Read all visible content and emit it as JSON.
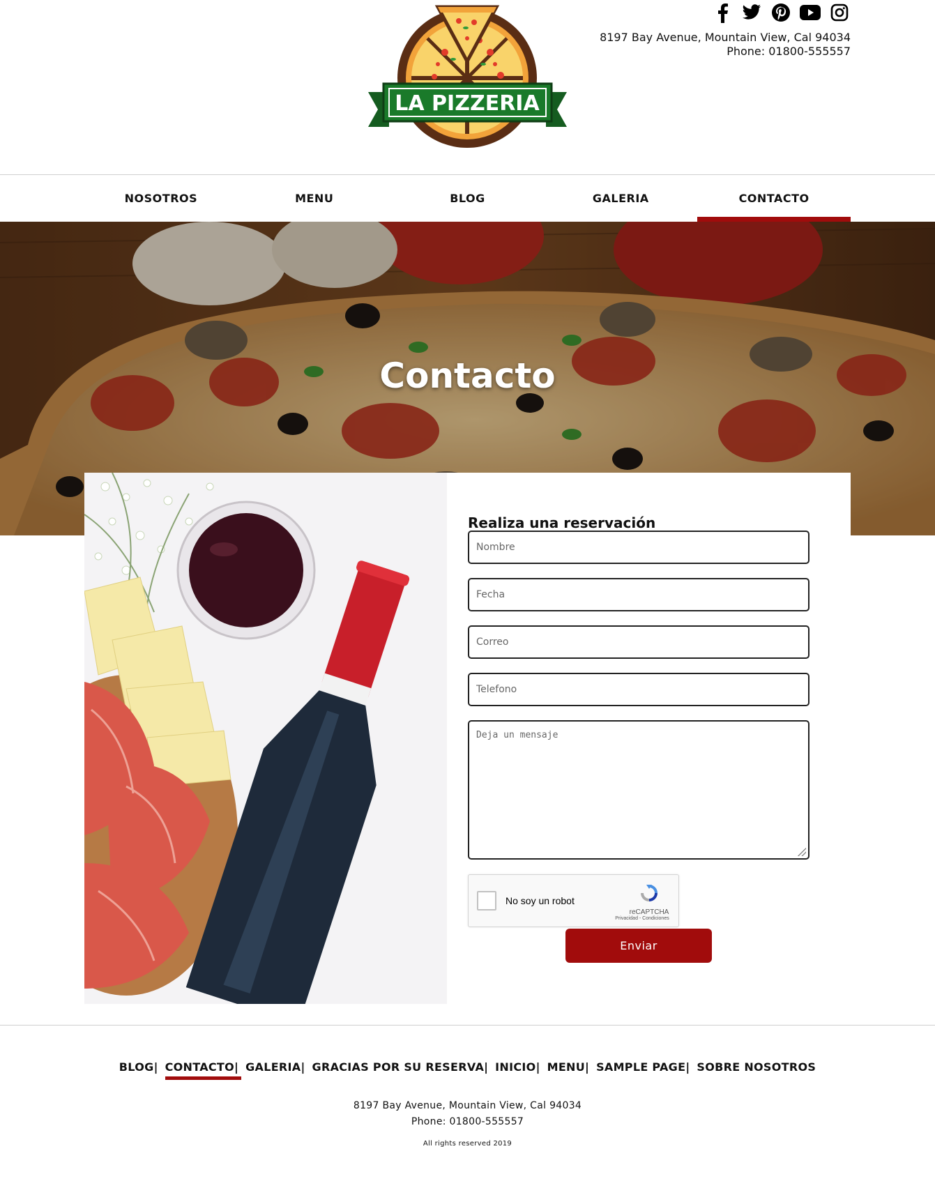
{
  "brand": {
    "logo_text": "LA PIZZERIA",
    "accent_color": "#a10c0c",
    "logo_green": "#1a7a2a"
  },
  "social": [
    {
      "name": "facebook-icon"
    },
    {
      "name": "twitter-icon"
    },
    {
      "name": "pinterest-icon"
    },
    {
      "name": "youtube-icon"
    },
    {
      "name": "instagram-icon"
    }
  ],
  "contact": {
    "address": "8197 Bay Avenue, Mountain View, Cal 94034",
    "phone": "Phone: 01800-555557"
  },
  "nav": {
    "items": [
      {
        "label": "NOSOTROS"
      },
      {
        "label": "MENU"
      },
      {
        "label": "BLOG"
      },
      {
        "label": "GALERIA"
      },
      {
        "label": "CONTACTO",
        "active": true
      }
    ]
  },
  "hero": {
    "title": "Contacto"
  },
  "form": {
    "title": "Realiza una reservación",
    "name_placeholder": "Nombre",
    "date_placeholder": "Fecha",
    "email_placeholder": "Correo",
    "phone_placeholder": "Telefono",
    "message_placeholder": "Deja un mensaje",
    "captcha_label": "No soy un robot",
    "captcha_brand": "reCAPTCHA",
    "captcha_terms": "Privacidad - Condiciones",
    "submit_label": "Enviar"
  },
  "footer": {
    "links": [
      {
        "label": "BLOG"
      },
      {
        "label": "CONTACTO",
        "active": true
      },
      {
        "label": "GALERIA"
      },
      {
        "label": "GRACIAS POR SU RESERVA"
      },
      {
        "label": "INICIO"
      },
      {
        "label": "MENU"
      },
      {
        "label": "SAMPLE PAGE"
      },
      {
        "label": "SOBRE NOSOTROS"
      }
    ],
    "address": "8197 Bay Avenue, Mountain View, Cal 94034",
    "phone": "Phone: 01800-555557",
    "rights": "All rights reserved 2019"
  }
}
